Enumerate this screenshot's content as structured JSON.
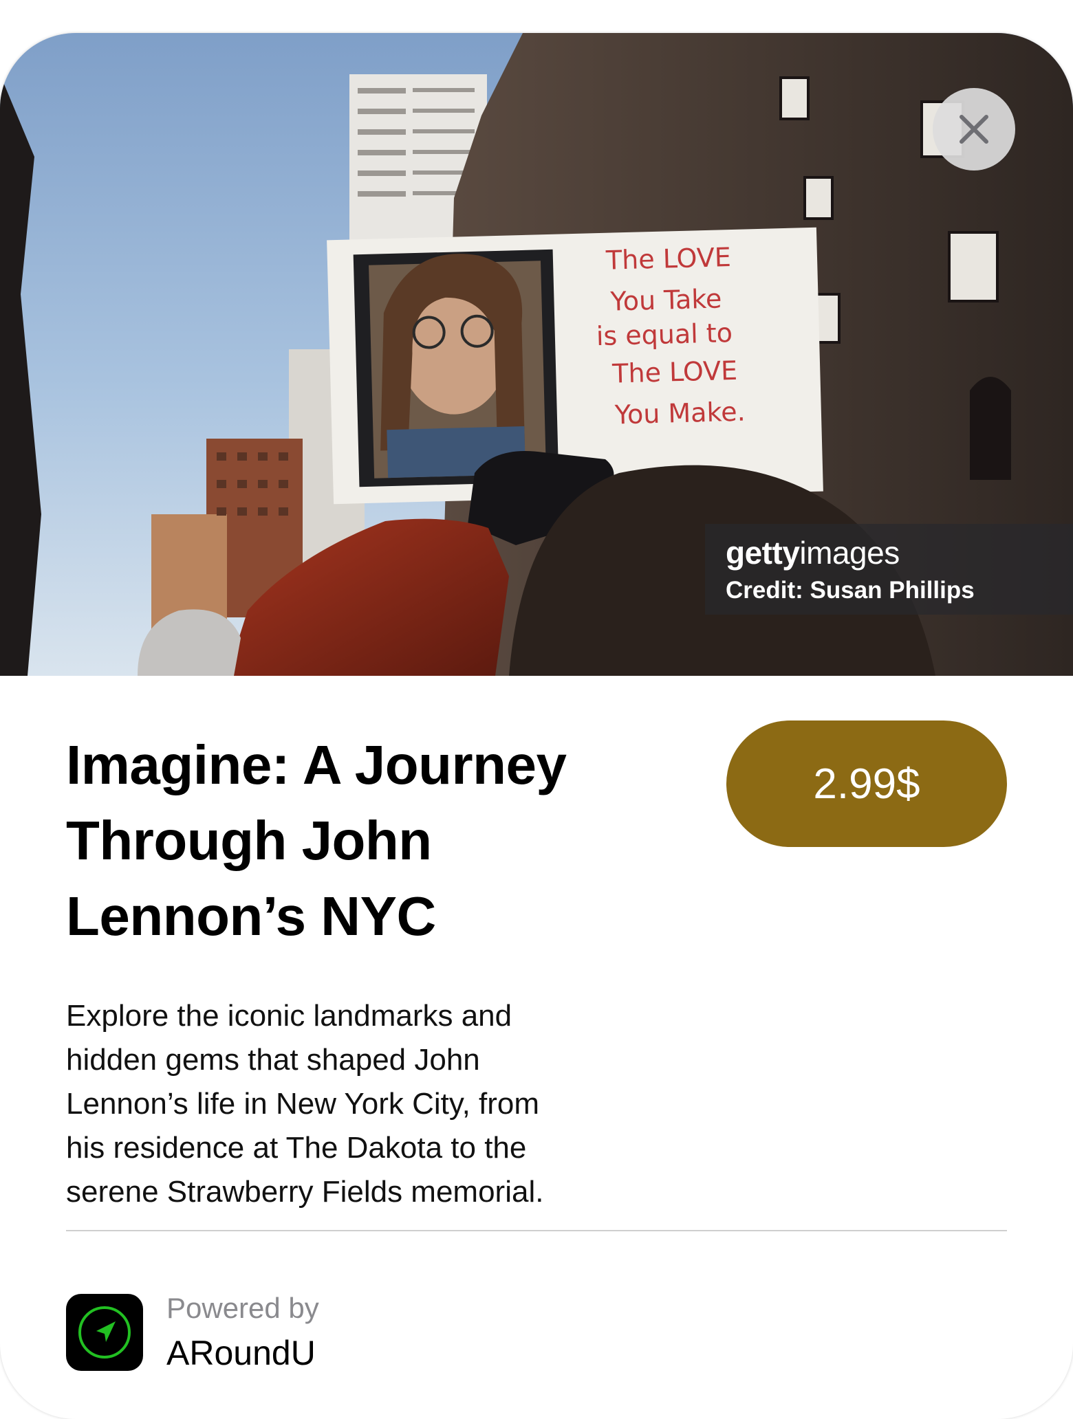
{
  "hero": {
    "sign_lines": [
      "The LOVE",
      "You Take",
      "is equal to",
      "The LOVE",
      "You Make."
    ],
    "watermark": {
      "brand_bold": "getty",
      "brand_light": "images",
      "credit": "Credit: Susan Phillips"
    },
    "close_icon": "close-icon"
  },
  "tour": {
    "title_lines": [
      "Imagine: A Journey",
      "Through John",
      "Lennon’s NYC"
    ],
    "price_label": "2.99$",
    "description_lines": [
      "Explore the iconic landmarks and",
      "hidden gems that shaped John",
      "Lennon’s life in New York City, from",
      "his residence at The Dakota to the",
      "serene Strawberry Fields memorial."
    ]
  },
  "footer": {
    "powered_label": "Powered by",
    "brand_name": "ARoundU",
    "app_icon": "navigation-arrow-icon"
  },
  "colors": {
    "price_button": "#8c6a14",
    "app_icon_bg": "#000000",
    "app_icon_accent": "#22c022"
  }
}
